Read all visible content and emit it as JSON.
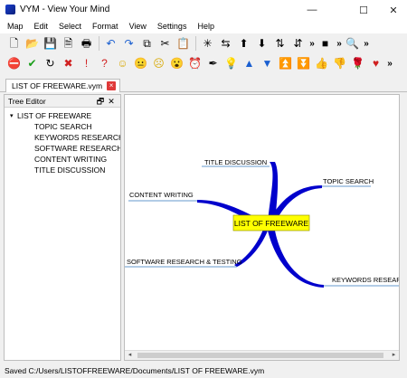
{
  "window": {
    "title": "VYM - View Your Mind",
    "minimize": "—",
    "maximize": "☐",
    "close": "✕"
  },
  "menu": [
    "Map",
    "Edit",
    "Select",
    "Format",
    "View",
    "Settings",
    "Help"
  ],
  "toolbar1": [
    {
      "name": "new-map-icon",
      "glyph": "🗋"
    },
    {
      "name": "open-map-icon",
      "glyph": "📂"
    },
    {
      "name": "save-map-icon",
      "glyph": "💾"
    },
    {
      "name": "export-icon",
      "glyph": "🗎"
    },
    {
      "name": "print-icon",
      "glyph": "🖶"
    },
    {
      "sep": true
    },
    {
      "name": "undo-icon",
      "glyph": "↶"
    },
    {
      "name": "redo-icon",
      "glyph": "↷"
    },
    {
      "name": "copy-icon",
      "glyph": "⧉"
    },
    {
      "name": "cut-icon",
      "glyph": "✂"
    },
    {
      "name": "paste-icon",
      "glyph": "📋"
    },
    {
      "sep": true
    },
    {
      "name": "add-branch-icon",
      "glyph": "✳"
    },
    {
      "name": "add-branch-above-icon",
      "glyph": "⇆"
    },
    {
      "name": "move-up-icon",
      "glyph": "⬆"
    },
    {
      "name": "move-down-icon",
      "glyph": "⬇"
    },
    {
      "name": "sort-ascending-icon",
      "glyph": "⇅"
    },
    {
      "name": "sort-descending-icon",
      "glyph": "⇵"
    },
    {
      "more": true
    },
    {
      "name": "color-icon",
      "glyph": "■"
    },
    {
      "more": true
    },
    {
      "name": "zoom-icon",
      "glyph": "🔍"
    },
    {
      "more": true
    }
  ],
  "toolbar2": [
    {
      "name": "stop-flag-icon",
      "glyph": "⛔"
    },
    {
      "name": "check-flag-icon",
      "glyph": "✔"
    },
    {
      "name": "refresh-flag-icon",
      "glyph": "↻"
    },
    {
      "name": "cross-flag-icon",
      "glyph": "✖"
    },
    {
      "name": "exclamation-flag-icon",
      "glyph": "!"
    },
    {
      "name": "question-flag-icon",
      "glyph": "?"
    },
    {
      "name": "smiley-good-icon",
      "glyph": "☺"
    },
    {
      "name": "smiley-neutral-icon",
      "glyph": "😐"
    },
    {
      "name": "smiley-bad-icon",
      "glyph": "☹"
    },
    {
      "name": "smiley-omg-icon",
      "glyph": "😮"
    },
    {
      "name": "clock-flag-icon",
      "glyph": "⏰"
    },
    {
      "name": "pen-flag-icon",
      "glyph": "✒"
    },
    {
      "name": "lamp-flag-icon",
      "glyph": "💡"
    },
    {
      "name": "arrow-up-flag-icon",
      "glyph": "▲"
    },
    {
      "name": "arrow-down-flag-icon",
      "glyph": "▼"
    },
    {
      "name": "double-up-flag-icon",
      "glyph": "⏫"
    },
    {
      "name": "double-down-flag-icon",
      "glyph": "⏬"
    },
    {
      "name": "thumbs-up-flag-icon",
      "glyph": "👍"
    },
    {
      "name": "thumbs-down-flag-icon",
      "glyph": "👎"
    },
    {
      "name": "rose-flag-icon",
      "glyph": "🌹"
    },
    {
      "name": "heart-flag-icon",
      "glyph": "♥"
    },
    {
      "more": true
    }
  ],
  "tab": {
    "label": "LIST OF FREEWARE.vym",
    "close": "×"
  },
  "tree_editor": {
    "title": "Tree Editor",
    "float_glyph": "🗗",
    "close_glyph": "✕",
    "root": "LIST OF FREEWARE",
    "children": [
      "TOPIC SEARCH",
      "KEYWORDS RESEARCH",
      "SOFTWARE RESEARCH ...",
      "CONTENT WRITING",
      "TITLE DISCUSSION"
    ]
  },
  "mindmap": {
    "root": "LIST OF FREEWARE",
    "branches": [
      "TITLE DISCUSSION",
      "TOPIC SEARCH",
      "CONTENT WRITING",
      "SOFTWARE RESEARCH & TESTING",
      "KEYWORDS RESEARCH"
    ],
    "root_fill": "#ffff00",
    "branch_color": "#0000cc"
  },
  "status": "Saved  C:/Users/LISTOFFREEWARE/Documents/LIST OF FREEWARE.vym"
}
